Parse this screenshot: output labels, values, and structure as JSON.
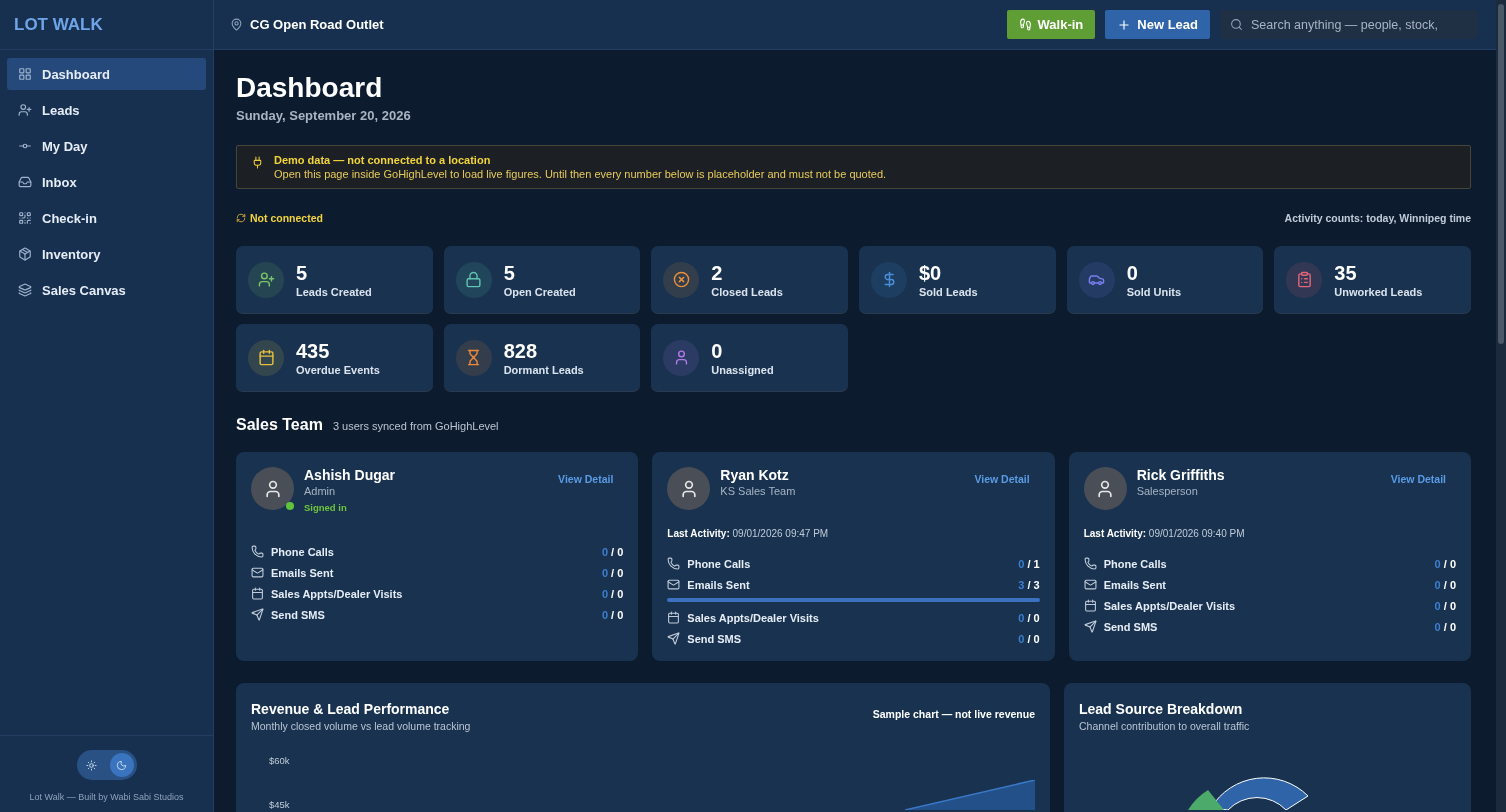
{
  "sidebar": {
    "brand": "LOT WALK",
    "items": [
      {
        "label": "Dashboard",
        "selected": true
      },
      {
        "label": "Leads",
        "selected": false
      },
      {
        "label": "My Day",
        "selected": false
      },
      {
        "label": "Inbox",
        "selected": false
      },
      {
        "label": "Check-in",
        "selected": false
      },
      {
        "label": "Inventory",
        "selected": false
      },
      {
        "label": "Sales Canvas",
        "selected": false
      }
    ],
    "theme_toggle": {
      "dark": true
    },
    "footer": "Lot Walk — Built by Wabi Sabi Studios"
  },
  "header": {
    "location": "CG Open Road Outlet",
    "walk_in": "Walk-in",
    "new_lead": "New Lead",
    "search": {
      "placeholder": "Search anything — people, stock,"
    }
  },
  "page": {
    "title": "Dashboard",
    "date": "Sunday, September 20, 2026"
  },
  "banner": {
    "title": "Demo data — not connected to a location",
    "text": "Open this page inside GoHighLevel to load live figures. Until then every number below is placeholder and must not be quoted."
  },
  "status": {
    "connection": "Not connected",
    "note": "Activity counts: today, Winnipeg time"
  },
  "stats": [
    {
      "value": "5",
      "label": "Leads Created",
      "color": "#7cc46a"
    },
    {
      "value": "5",
      "label": "Open Created",
      "color": "#5fc4b0"
    },
    {
      "value": "2",
      "label": "Closed Leads",
      "color": "#e8903a"
    },
    {
      "value": "$0",
      "label": "Sold Leads",
      "color": "#4a8fd8"
    },
    {
      "value": "0",
      "label": "Sold Units",
      "color": "#7a7ff0"
    },
    {
      "value": "35",
      "label": "Unworked Leads",
      "color": "#e0647a"
    },
    {
      "value": "435",
      "label": "Overdue Events",
      "color": "#e8c040"
    },
    {
      "value": "828",
      "label": "Dormant Leads",
      "color": "#ec8a3c"
    },
    {
      "value": "0",
      "label": "Unassigned",
      "color": "#b07ae8"
    }
  ],
  "sales_team": {
    "title": "Sales Team",
    "subtitle": "3 users synced from GoHighLevel",
    "members": [
      {
        "name": "Ashish Dugar",
        "role": "Admin",
        "online": true,
        "status": "Signed in",
        "link": "View Detail",
        "metrics": [
          {
            "label": "Phone Calls",
            "done": "0",
            "total": "/ 0"
          },
          {
            "label": "Emails Sent",
            "done": "0",
            "total": "/ 0"
          },
          {
            "label": "Sales Appts/Dealer Visits",
            "done": "0",
            "total": "/ 0"
          },
          {
            "label": "Send SMS",
            "done": "0",
            "total": "/ 0"
          }
        ]
      },
      {
        "name": "Ryan Kotz",
        "role": "KS Sales Team",
        "online": false,
        "last_activity_label": "Last Activity:",
        "last_activity": "09/01/2026 09:47 PM",
        "link": "View Detail",
        "metrics": [
          {
            "label": "Phone Calls",
            "done": "0",
            "total": "/ 1"
          },
          {
            "label": "Emails Sent",
            "done": "3",
            "total": "/ 3",
            "level": 1
          },
          {
            "label": "Sales Appts/Dealer Visits",
            "done": "0",
            "total": "/ 0"
          },
          {
            "label": "Send SMS",
            "done": "0",
            "total": "/ 0"
          }
        ]
      },
      {
        "name": "Rick Griffiths",
        "role": "Salesperson",
        "online": false,
        "last_activity_label": "Last Activity:",
        "last_activity": "09/01/2026 09:40 PM",
        "link": "View Detail",
        "metrics": [
          {
            "label": "Phone Calls",
            "done": "0",
            "total": "/ 0"
          },
          {
            "label": "Emails Sent",
            "done": "0",
            "total": "/ 0"
          },
          {
            "label": "Sales Appts/Dealer Visits",
            "done": "0",
            "total": "/ 0"
          },
          {
            "label": "Send SMS",
            "done": "0",
            "total": "/ 0"
          }
        ]
      }
    ]
  },
  "revenue_panel": {
    "title": "Revenue & Lead Performance",
    "subtitle": "Monthly closed volume vs lead volume tracking",
    "note": "Sample chart — not live revenue",
    "y_tick_labels": [
      "$60k",
      "$45k"
    ]
  },
  "source_panel": {
    "title": "Lead Source Breakdown",
    "subtitle": "Channel contribution to overall traffic"
  }
}
